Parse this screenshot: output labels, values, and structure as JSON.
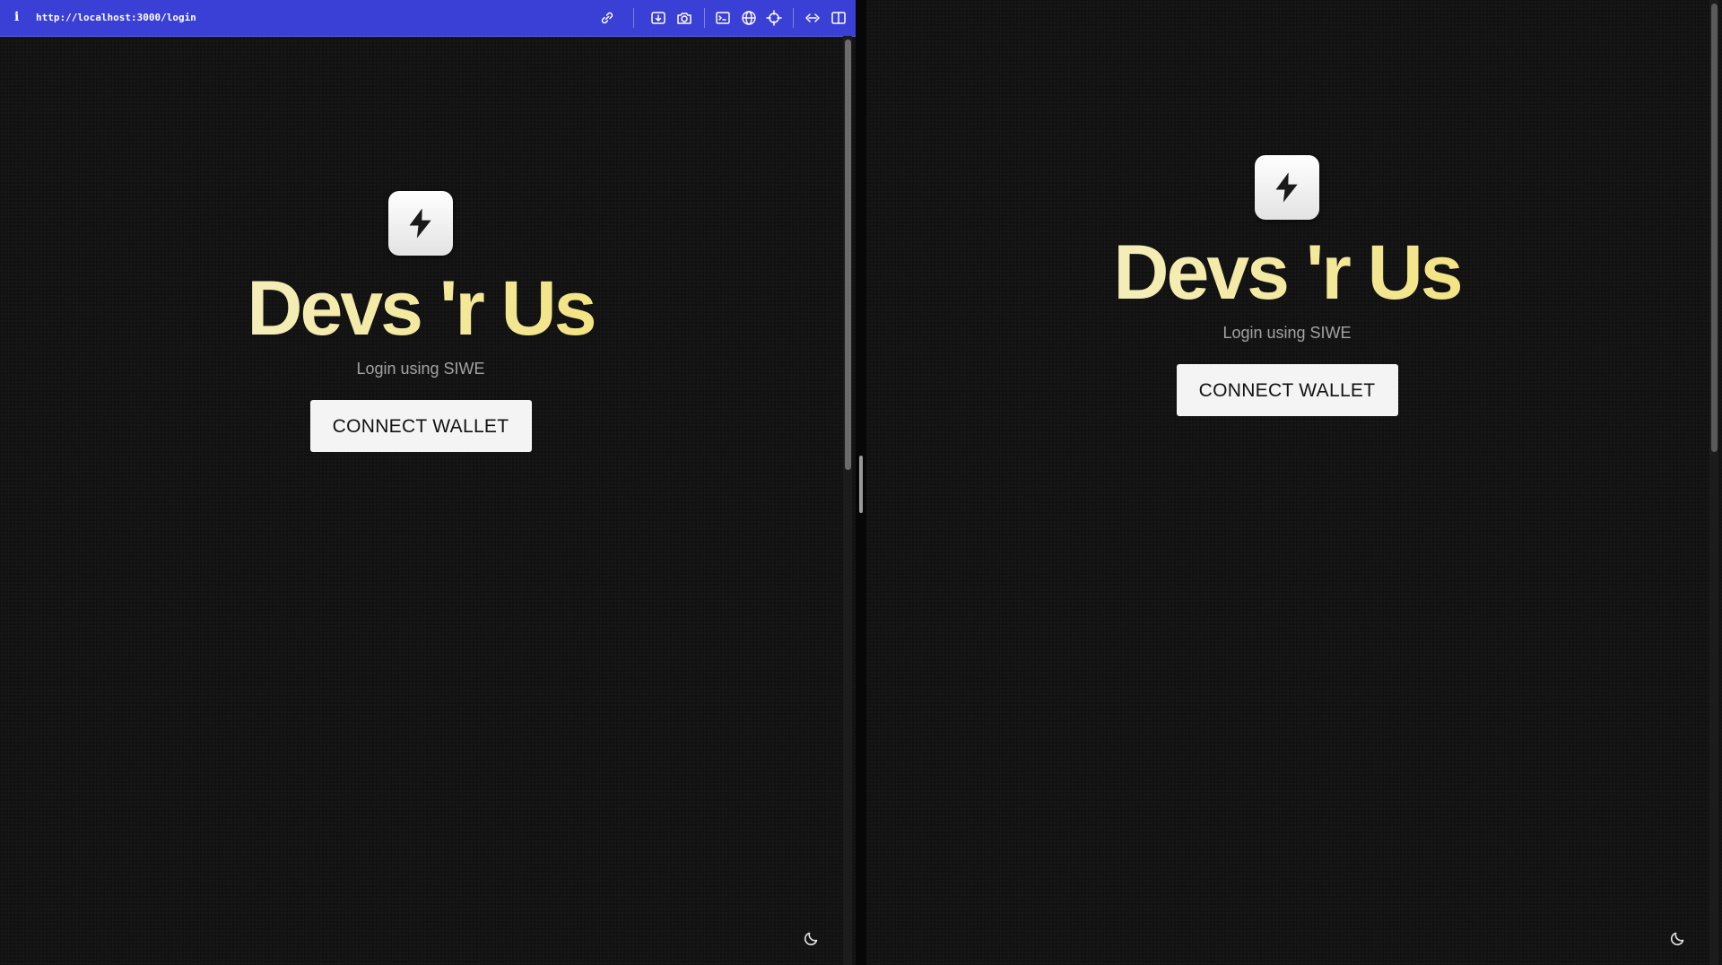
{
  "browser": {
    "url": "http://localhost:3000/login",
    "info_glyph": "i",
    "toolbar_icons": [
      "link-icon",
      "download-icon",
      "camera-icon",
      "terminal-icon",
      "globe-icon",
      "crosshair-icon",
      "code-arrows-icon",
      "split-view-icon"
    ]
  },
  "left_page": {
    "logo_icon": "lightning-bolt-icon",
    "title": "Devs 'r Us",
    "subtitle": "Login using SIWE",
    "connect_button": "CONNECT WALLET",
    "theme_icon": "moon-icon"
  },
  "right_page": {
    "logo_icon": "lightning-bolt-icon",
    "title": "Devs 'r Us",
    "subtitle": "Login using SIWE",
    "connect_button": "CONNECT WALLET",
    "theme_icon": "moon-icon"
  },
  "colors": {
    "background": "#121212",
    "browser_bar": "#3a3fd6",
    "title_gradient_start": "#f4efc2",
    "title_gradient_end": "#f3e27c",
    "subtitle": "#a3a3a3",
    "button_bg": "#f4f4f4"
  }
}
